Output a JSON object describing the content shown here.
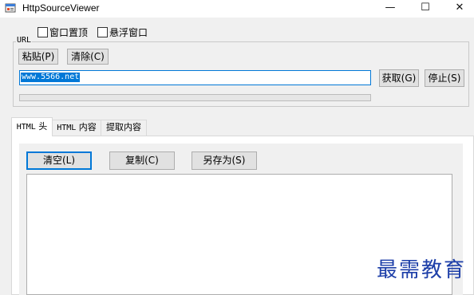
{
  "window": {
    "title": "HttpSourceViewer",
    "controls": {
      "minimize": "—",
      "maximize": "☐",
      "close": "✕"
    }
  },
  "options": {
    "always_on_top": "窗口置顶",
    "floating_window": "悬浮窗口"
  },
  "url_group": {
    "label": "URL",
    "paste_button": "粘贴(P)",
    "clear_button": "清除(C)",
    "url_value": "www.5566.net",
    "fetch_button": "获取(G)",
    "stop_button": "停止(S)",
    "progress": 0
  },
  "tabs": [
    {
      "label_latin": "HTML",
      "label_cjk": " 头",
      "active": true
    },
    {
      "label_latin": "HTML",
      "label_cjk": " 内容",
      "active": false
    },
    {
      "label_latin": "",
      "label_cjk": "提取内容",
      "active": false
    }
  ],
  "panel": {
    "clear_button": "清空(L)",
    "copy_button": "复制(C)",
    "save_as_button": "另存为(S)",
    "content": ""
  },
  "watermark": "最需教育",
  "colors": {
    "accent": "#0078d7",
    "watermark": "#1c3ea8"
  }
}
